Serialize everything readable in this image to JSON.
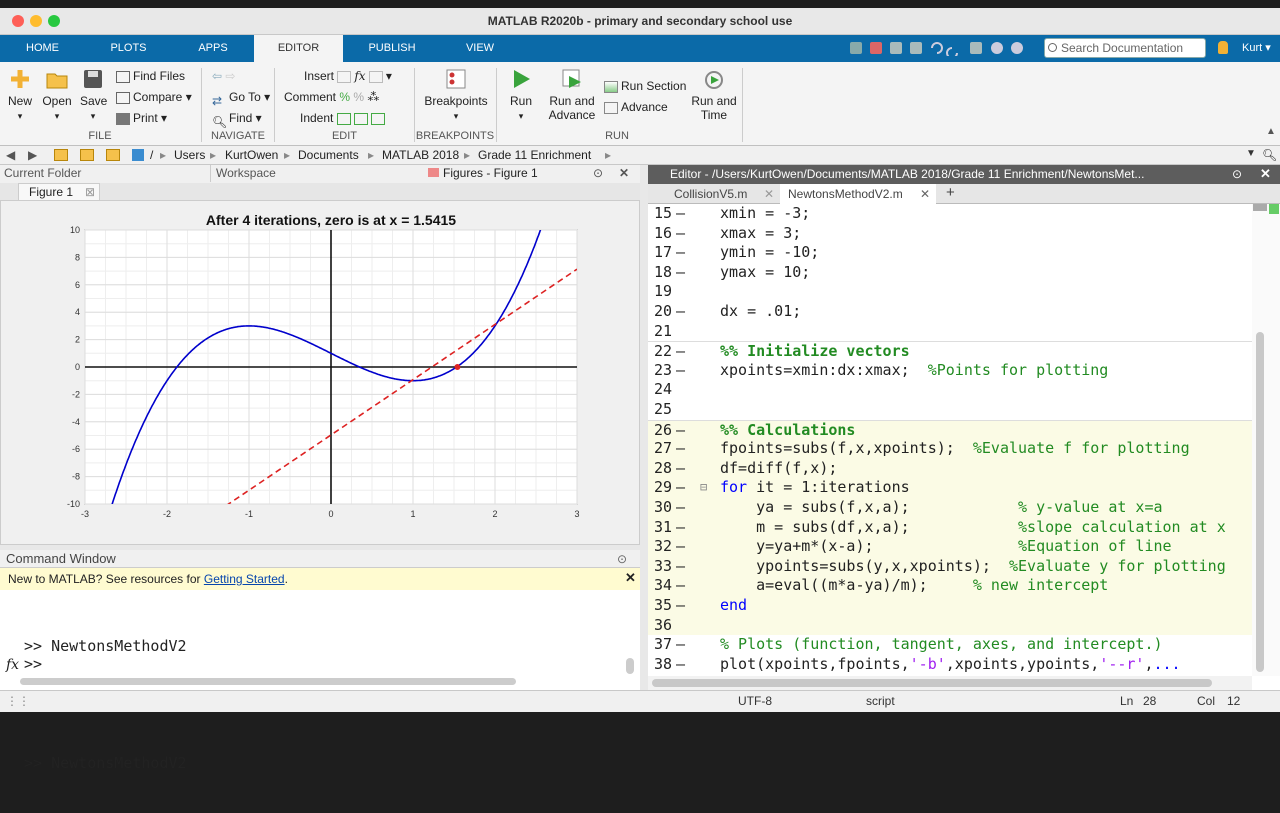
{
  "window": {
    "title": "MATLAB R2020b - primary and secondary school use"
  },
  "tabs": [
    "HOME",
    "PLOTS",
    "APPS",
    "EDITOR",
    "PUBLISH",
    "VIEW"
  ],
  "active_tab": "EDITOR",
  "search": {
    "placeholder": "Search Documentation"
  },
  "user": "Kurt",
  "toolstrip": {
    "file": {
      "new": "New",
      "open": "Open",
      "save": "Save",
      "find_files": "Find Files",
      "compare": "Compare",
      "print": "Print",
      "section": "FILE"
    },
    "navigate": {
      "goto": "Go To",
      "find": "Find",
      "section": "NAVIGATE"
    },
    "edit": {
      "insert": "Insert",
      "comment": "Comment",
      "indent": "Indent",
      "section": "EDIT"
    },
    "breakpoints": {
      "label": "Breakpoints",
      "section": "BREAKPOINTS"
    },
    "run": {
      "run": "Run",
      "run_and_advance_1": "Run and",
      "run_and_advance_2": "Advance",
      "run_section": "Run Section",
      "advance": "Advance",
      "run_and_time_1": "Run and",
      "run_and_time_2": "Time",
      "section": "RUN"
    }
  },
  "address": {
    "root": "/",
    "path": [
      "Users",
      "KurtOwen",
      "Documents",
      "MATLAB 2018",
      "Grade 11 Enrichment"
    ]
  },
  "left": {
    "current_folder": "Current Folder",
    "workspace": "Workspace",
    "figures_title": "Figures - Figure 1",
    "figure_tab": "Figure 1"
  },
  "chart_data": {
    "type": "line",
    "title": "After 4 iterations, zero is at x = 1.5415",
    "xlim": [
      -3,
      3
    ],
    "ylim": [
      -10,
      10
    ],
    "xticks": [
      "-3",
      "-2",
      "-1",
      "0",
      "1",
      "2",
      "3"
    ],
    "yticks": [
      "10",
      "8",
      "6",
      "4",
      "2",
      "0",
      "-2",
      "-4",
      "-6",
      "-8",
      "-10"
    ],
    "grid": true,
    "series": [
      {
        "style": "solid",
        "color": "#0000cc",
        "function": "x^3 - 3x + 1",
        "x": [
          -3,
          -2.5,
          -2,
          -1.5,
          -1,
          -0.5,
          0,
          0.5,
          1,
          1.5,
          2,
          2.5,
          3
        ],
        "y": [
          -17,
          -7.125,
          -1,
          2.125,
          3,
          2.375,
          1,
          -0.375,
          -1,
          -0.125,
          3,
          9.125,
          19
        ]
      },
      {
        "style": "dashed",
        "color": "#dd2222",
        "x": [
          -3,
          3
        ],
        "y": [
          -17.06,
          7.14
        ]
      }
    ],
    "marker": {
      "x": 1.5415,
      "y": 0
    }
  },
  "command_window": {
    "title": "Command Window",
    "notice": "New to MATLAB? See resources for ",
    "notice_link": "Getting Started",
    "notice_end": ".",
    "history": [
      ">> NewtonsMethodV2",
      ">> NewtonsMethodV2",
      ">> NewtonsMethodV2"
    ],
    "prompt": ">>"
  },
  "editor": {
    "header": "Editor - /Users/KurtOwen/Documents/MATLAB 2018/Grade 11 Enrichment/NewtonsMet...",
    "tabs": [
      "CollisionV5.m",
      "NewtonsMethodV2.m",
      "+"
    ],
    "lines": [
      {
        "n": "15",
        "parts": [
          [
            "",
            "xmin = -3;"
          ]
        ]
      },
      {
        "n": "16",
        "parts": [
          [
            "",
            "xmax = 3;"
          ]
        ]
      },
      {
        "n": "17",
        "parts": [
          [
            "",
            "ymin = -10;"
          ]
        ]
      },
      {
        "n": "18",
        "parts": [
          [
            "",
            "ymax = 10;"
          ]
        ]
      },
      {
        "n": "19",
        "parts": []
      },
      {
        "n": "20",
        "parts": [
          [
            "",
            "dx = .01;"
          ]
        ]
      },
      {
        "n": "21",
        "parts": []
      },
      {
        "n": "22",
        "parts": [
          [
            "cell",
            "%% Initialize vectors"
          ]
        ]
      },
      {
        "n": "23",
        "parts": [
          [
            "",
            "xpoints=xmin:dx:xmax;  "
          ],
          [
            "cm",
            "%Points for plotting"
          ]
        ]
      },
      {
        "n": "24",
        "parts": []
      },
      {
        "n": "25",
        "parts": []
      },
      {
        "n": "26",
        "parts": [
          [
            "cell",
            "%% Calculations"
          ]
        ]
      },
      {
        "n": "27",
        "parts": [
          [
            "",
            "fpoints=subs(f,x,xpoints);  "
          ],
          [
            "cm",
            "%Evaluate f for plotting"
          ]
        ]
      },
      {
        "n": "28",
        "parts": [
          [
            "",
            "df=diff(f,x);"
          ]
        ]
      },
      {
        "n": "29",
        "parts": [
          [
            "kw",
            "for"
          ],
          [
            "",
            " it = 1:iterations"
          ]
        ]
      },
      {
        "n": "30",
        "parts": [
          [
            "",
            "    ya = subs(f,x,a);            "
          ],
          [
            "cm",
            "% y-value at x=a"
          ]
        ]
      },
      {
        "n": "31",
        "parts": [
          [
            "",
            "    m = subs(df,x,a);            "
          ],
          [
            "cm",
            "%slope calculation at x"
          ]
        ]
      },
      {
        "n": "32",
        "parts": [
          [
            "",
            "    y=ya+m*(x-a);                "
          ],
          [
            "cm",
            "%Equation of line"
          ]
        ]
      },
      {
        "n": "33",
        "parts": [
          [
            "",
            "    ypoints=subs(y,x,xpoints);  "
          ],
          [
            "cm",
            "%Evaluate y for plotting"
          ]
        ]
      },
      {
        "n": "34",
        "parts": [
          [
            "",
            "    a=eval((m*a-ya)/m);     "
          ],
          [
            "cm",
            "% new intercept"
          ]
        ]
      },
      {
        "n": "35",
        "parts": [
          [
            "kw",
            "end"
          ]
        ]
      },
      {
        "n": "36",
        "parts": []
      },
      {
        "n": "37",
        "parts": [
          [
            "cm",
            "% Plots (function, tangent, axes, and intercept.)"
          ]
        ]
      },
      {
        "n": "38",
        "parts": [
          [
            "",
            "plot(xpoints,fpoints,"
          ],
          [
            "str",
            "'-b'"
          ],
          [
            "",
            ",xpoints,ypoints,"
          ],
          [
            "str",
            "'--r'"
          ],
          [
            "",
            ","
          ],
          [
            "kw",
            "..."
          ]
        ]
      }
    ]
  },
  "status": {
    "encoding": "UTF-8",
    "type": "script",
    "ln_label": "Ln",
    "ln": "28",
    "col_label": "Col",
    "col": "12"
  },
  "colors": {
    "tab_bar": "#0b6aa8",
    "editor_header": "#5d5d5d",
    "cell_bg": "#fbfbe5",
    "notice_bg": "#fffbd0"
  }
}
